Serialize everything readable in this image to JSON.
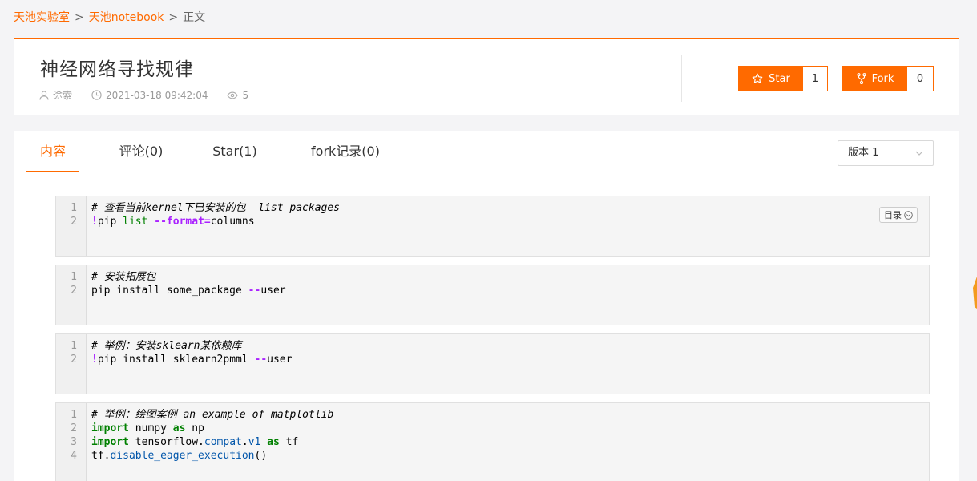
{
  "breadcrumb": {
    "items": [
      "天池实验室",
      "天池notebook"
    ],
    "current": "正文",
    "separator": ">"
  },
  "header": {
    "title": "神经网络寻找规律",
    "author": "途索",
    "datetime": "2021-03-18 09:42:04",
    "views": "5",
    "star_label": "Star",
    "star_count": "1",
    "fork_label": "Fork",
    "fork_count": "0"
  },
  "tabs": [
    {
      "label": "内容",
      "active": true
    },
    {
      "label": "评论(0)",
      "active": false
    },
    {
      "label": "Star(1)",
      "active": false
    },
    {
      "label": "fork记录(0)",
      "active": false
    }
  ],
  "version_select": {
    "value": "版本 1"
  },
  "toc_label": "目录",
  "cells": [
    {
      "lines": [
        {
          "num": "1",
          "text": "# 查看当前kernel下已安装的包  list packages"
        },
        {
          "num": "2",
          "p1": "!",
          "p2": "pip ",
          "p3": "list ",
          "p4": "--format",
          "p5": "=",
          "p6": "columns"
        }
      ]
    },
    {
      "lines": [
        {
          "num": "1",
          "text": "# 安装拓展包"
        },
        {
          "num": "2",
          "p1": "pip install some_package ",
          "p2": "--",
          "p3": "user"
        }
      ]
    },
    {
      "lines": [
        {
          "num": "1",
          "text": "# 举例：安装sklearn某依赖库"
        },
        {
          "num": "2",
          "p1": "!",
          "p2": "pip install sklearn2pmml ",
          "p3": "--",
          "p4": "user"
        }
      ]
    },
    {
      "lines": [
        {
          "num": "1",
          "text": "# 举例：绘图案例 an example of matplotlib"
        },
        {
          "num": "2",
          "kw1": "import",
          "p1": " numpy ",
          "kw2": "as",
          "p2": " np"
        },
        {
          "num": "3",
          "kw1": "import",
          "p1": " tensorflow.",
          "a1": "compat",
          "p2": ".",
          "a2": "v1",
          "p3": " ",
          "kw2": "as",
          "p4": " tf"
        },
        {
          "num": "4",
          "p1": "tf.",
          "a1": "disable_eager_execution",
          "p2": "()"
        }
      ]
    }
  ],
  "colors": {
    "accent": "#ff6a00"
  }
}
